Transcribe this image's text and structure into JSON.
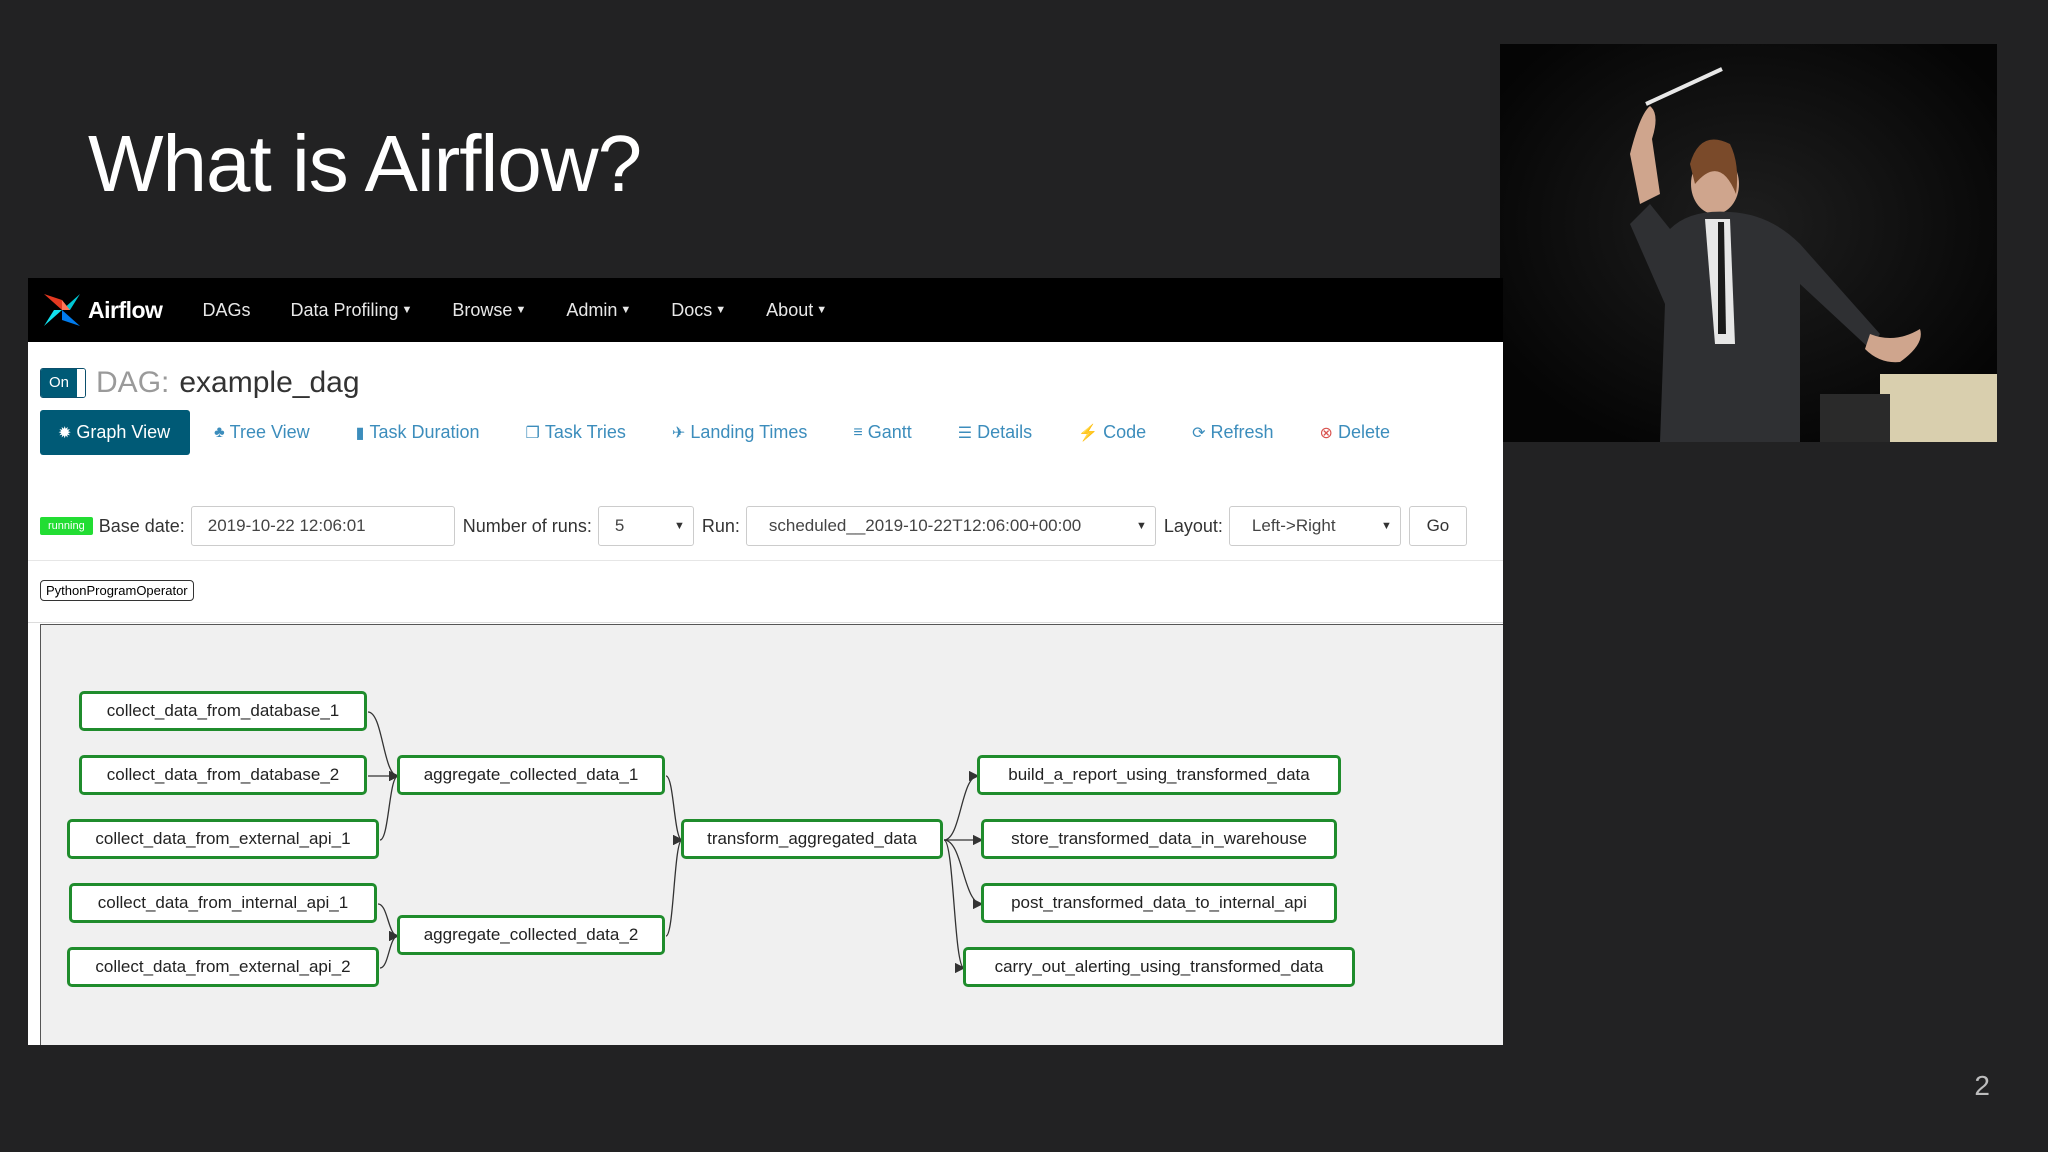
{
  "slide": {
    "title": "What is Airflow?",
    "page_number": "2"
  },
  "navbar": {
    "brand": "Airflow",
    "items": [
      {
        "label": "DAGs",
        "dropdown": false
      },
      {
        "label": "Data Profiling",
        "dropdown": true
      },
      {
        "label": "Browse",
        "dropdown": true
      },
      {
        "label": "Admin",
        "dropdown": true
      },
      {
        "label": "Docs",
        "dropdown": true
      },
      {
        "label": "About",
        "dropdown": true
      }
    ]
  },
  "dag": {
    "toggle_label": "On",
    "label": "DAG:",
    "name": "example_dag"
  },
  "tabs": [
    {
      "label": "Graph View",
      "icon": "asterisk-icon",
      "active": true
    },
    {
      "label": "Tree View",
      "icon": "tree-icon"
    },
    {
      "label": "Task Duration",
      "icon": "bar-chart-icon"
    },
    {
      "label": "Task Tries",
      "icon": "files-icon"
    },
    {
      "label": "Landing Times",
      "icon": "plane-icon"
    },
    {
      "label": "Gantt",
      "icon": "gantt-icon"
    },
    {
      "label": "Details",
      "icon": "list-icon"
    },
    {
      "label": "Code",
      "icon": "flash-icon"
    },
    {
      "label": "Refresh",
      "icon": "refresh-icon"
    },
    {
      "label": "Delete",
      "icon": "remove-circle-icon"
    }
  ],
  "controls": {
    "state_badge": "running",
    "base_date_label": "Base date:",
    "base_date_value": "2019-10-22 12:06:01",
    "num_runs_label": "Number of runs:",
    "num_runs_value": "5",
    "run_label": "Run:",
    "run_value": "scheduled__2019-10-22T12:06:00+00:00",
    "layout_label": "Layout:",
    "layout_value": "Left->Right",
    "go_label": "Go"
  },
  "legend": {
    "operator": "PythonProgramOperator"
  },
  "graph": {
    "nodes": {
      "n1": "collect_data_from_database_1",
      "n2": "collect_data_from_database_2",
      "n3": "collect_data_from_external_api_1",
      "n4": "collect_data_from_internal_api_1",
      "n5": "collect_data_from_external_api_2",
      "a1": "aggregate_collected_data_1",
      "a2": "aggregate_collected_data_2",
      "t": "transform_aggregated_data",
      "o1": "build_a_report_using_transformed_data",
      "o2": "store_transformed_data_in_warehouse",
      "o3": "post_transformed_data_to_internal_api",
      "o4": "carry_out_alerting_using_transformed_data"
    },
    "edges": [
      [
        "n1",
        "a1"
      ],
      [
        "n2",
        "a1"
      ],
      [
        "n3",
        "a1"
      ],
      [
        "n4",
        "a2"
      ],
      [
        "n5",
        "a2"
      ],
      [
        "a1",
        "t"
      ],
      [
        "a2",
        "t"
      ],
      [
        "t",
        "o1"
      ],
      [
        "t",
        "o2"
      ],
      [
        "t",
        "o3"
      ],
      [
        "t",
        "o4"
      ]
    ]
  },
  "colors": {
    "node_border": "#1f8c2c",
    "primary": "#005a76",
    "link": "#3c8dbc",
    "running": "#22dd33"
  }
}
